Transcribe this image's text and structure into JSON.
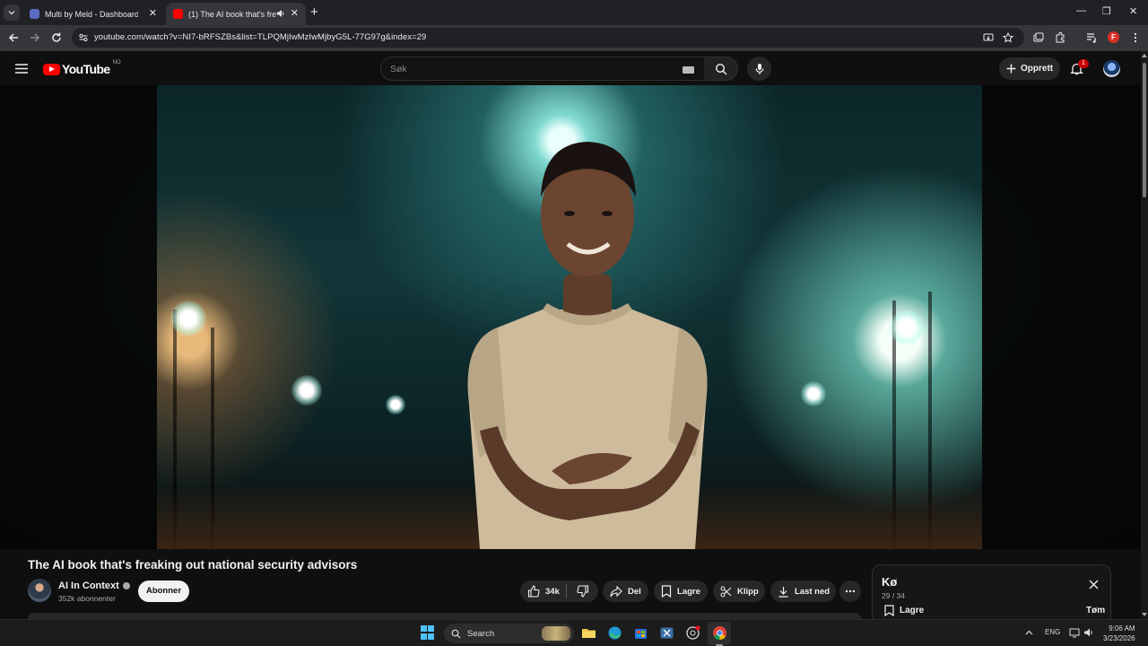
{
  "browser": {
    "tabs": [
      {
        "title": "Multi by Meld - Dashboard.",
        "active": false
      },
      {
        "title": "(1) The AI book that's freakin",
        "active": true
      }
    ],
    "url": "youtube.com/watch?v=NI7-bRFSZBs&list=TLPQMjIwMzIwMjbyG5L-77G97g&index=29",
    "profile_initial": "F"
  },
  "youtube": {
    "logo_text": "YouTube",
    "country_code": "NO",
    "search_placeholder": "Søk",
    "create_label": "Opprett",
    "notification_count": "1"
  },
  "video": {
    "title": "The AI book that's freaking out national security advisors",
    "channel": "AI In Context",
    "subscribers": "352k abonnenter",
    "subscribe_label": "Abonner",
    "likes": "34k",
    "share_label": "Del",
    "save_label": "Lagre",
    "clip_label": "Klipp",
    "download_label": "Last ned"
  },
  "queue": {
    "title": "Kø",
    "position": "29 / 34",
    "save_label": "Lagre",
    "clear_label": "Tøm"
  },
  "taskbar": {
    "search_label": "Search",
    "language": "ENG",
    "time": "9:06 AM",
    "date": "3/23/2026"
  },
  "colors": {
    "youtube_red": "#ff0000",
    "background": "#0f0f0f",
    "pill": "#272727"
  }
}
